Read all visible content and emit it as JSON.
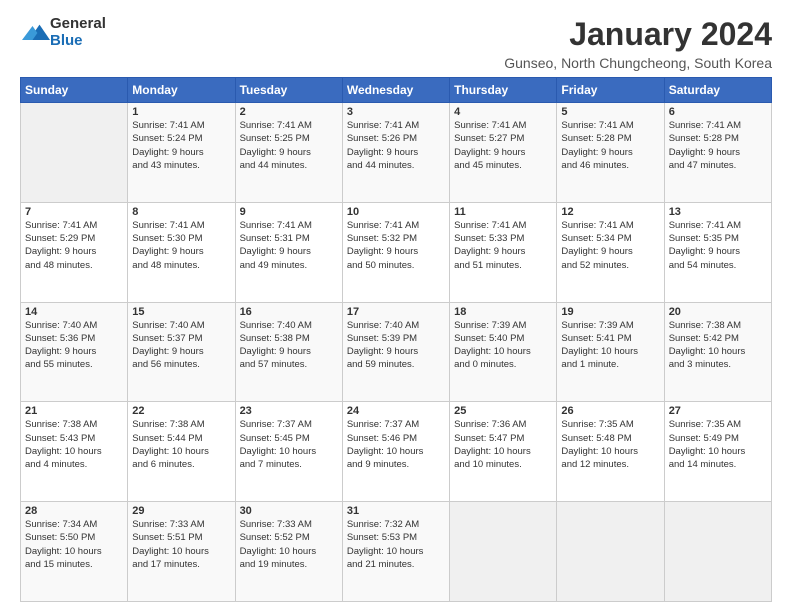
{
  "logo": {
    "general": "General",
    "blue": "Blue"
  },
  "title": "January 2024",
  "location": "Gunseo, North Chungcheong, South Korea",
  "days_of_week": [
    "Sunday",
    "Monday",
    "Tuesday",
    "Wednesday",
    "Thursday",
    "Friday",
    "Saturday"
  ],
  "weeks": [
    [
      {
        "day": "",
        "info": ""
      },
      {
        "day": "1",
        "info": "Sunrise: 7:41 AM\nSunset: 5:24 PM\nDaylight: 9 hours\nand 43 minutes."
      },
      {
        "day": "2",
        "info": "Sunrise: 7:41 AM\nSunset: 5:25 PM\nDaylight: 9 hours\nand 44 minutes."
      },
      {
        "day": "3",
        "info": "Sunrise: 7:41 AM\nSunset: 5:26 PM\nDaylight: 9 hours\nand 44 minutes."
      },
      {
        "day": "4",
        "info": "Sunrise: 7:41 AM\nSunset: 5:27 PM\nDaylight: 9 hours\nand 45 minutes."
      },
      {
        "day": "5",
        "info": "Sunrise: 7:41 AM\nSunset: 5:28 PM\nDaylight: 9 hours\nand 46 minutes."
      },
      {
        "day": "6",
        "info": "Sunrise: 7:41 AM\nSunset: 5:28 PM\nDaylight: 9 hours\nand 47 minutes."
      }
    ],
    [
      {
        "day": "7",
        "info": "Sunrise: 7:41 AM\nSunset: 5:29 PM\nDaylight: 9 hours\nand 48 minutes."
      },
      {
        "day": "8",
        "info": "Sunrise: 7:41 AM\nSunset: 5:30 PM\nDaylight: 9 hours\nand 48 minutes."
      },
      {
        "day": "9",
        "info": "Sunrise: 7:41 AM\nSunset: 5:31 PM\nDaylight: 9 hours\nand 49 minutes."
      },
      {
        "day": "10",
        "info": "Sunrise: 7:41 AM\nSunset: 5:32 PM\nDaylight: 9 hours\nand 50 minutes."
      },
      {
        "day": "11",
        "info": "Sunrise: 7:41 AM\nSunset: 5:33 PM\nDaylight: 9 hours\nand 51 minutes."
      },
      {
        "day": "12",
        "info": "Sunrise: 7:41 AM\nSunset: 5:34 PM\nDaylight: 9 hours\nand 52 minutes."
      },
      {
        "day": "13",
        "info": "Sunrise: 7:41 AM\nSunset: 5:35 PM\nDaylight: 9 hours\nand 54 minutes."
      }
    ],
    [
      {
        "day": "14",
        "info": "Sunrise: 7:40 AM\nSunset: 5:36 PM\nDaylight: 9 hours\nand 55 minutes."
      },
      {
        "day": "15",
        "info": "Sunrise: 7:40 AM\nSunset: 5:37 PM\nDaylight: 9 hours\nand 56 minutes."
      },
      {
        "day": "16",
        "info": "Sunrise: 7:40 AM\nSunset: 5:38 PM\nDaylight: 9 hours\nand 57 minutes."
      },
      {
        "day": "17",
        "info": "Sunrise: 7:40 AM\nSunset: 5:39 PM\nDaylight: 9 hours\nand 59 minutes."
      },
      {
        "day": "18",
        "info": "Sunrise: 7:39 AM\nSunset: 5:40 PM\nDaylight: 10 hours\nand 0 minutes."
      },
      {
        "day": "19",
        "info": "Sunrise: 7:39 AM\nSunset: 5:41 PM\nDaylight: 10 hours\nand 1 minute."
      },
      {
        "day": "20",
        "info": "Sunrise: 7:38 AM\nSunset: 5:42 PM\nDaylight: 10 hours\nand 3 minutes."
      }
    ],
    [
      {
        "day": "21",
        "info": "Sunrise: 7:38 AM\nSunset: 5:43 PM\nDaylight: 10 hours\nand 4 minutes."
      },
      {
        "day": "22",
        "info": "Sunrise: 7:38 AM\nSunset: 5:44 PM\nDaylight: 10 hours\nand 6 minutes."
      },
      {
        "day": "23",
        "info": "Sunrise: 7:37 AM\nSunset: 5:45 PM\nDaylight: 10 hours\nand 7 minutes."
      },
      {
        "day": "24",
        "info": "Sunrise: 7:37 AM\nSunset: 5:46 PM\nDaylight: 10 hours\nand 9 minutes."
      },
      {
        "day": "25",
        "info": "Sunrise: 7:36 AM\nSunset: 5:47 PM\nDaylight: 10 hours\nand 10 minutes."
      },
      {
        "day": "26",
        "info": "Sunrise: 7:35 AM\nSunset: 5:48 PM\nDaylight: 10 hours\nand 12 minutes."
      },
      {
        "day": "27",
        "info": "Sunrise: 7:35 AM\nSunset: 5:49 PM\nDaylight: 10 hours\nand 14 minutes."
      }
    ],
    [
      {
        "day": "28",
        "info": "Sunrise: 7:34 AM\nSunset: 5:50 PM\nDaylight: 10 hours\nand 15 minutes."
      },
      {
        "day": "29",
        "info": "Sunrise: 7:33 AM\nSunset: 5:51 PM\nDaylight: 10 hours\nand 17 minutes."
      },
      {
        "day": "30",
        "info": "Sunrise: 7:33 AM\nSunset: 5:52 PM\nDaylight: 10 hours\nand 19 minutes."
      },
      {
        "day": "31",
        "info": "Sunrise: 7:32 AM\nSunset: 5:53 PM\nDaylight: 10 hours\nand 21 minutes."
      },
      {
        "day": "",
        "info": ""
      },
      {
        "day": "",
        "info": ""
      },
      {
        "day": "",
        "info": ""
      }
    ]
  ]
}
